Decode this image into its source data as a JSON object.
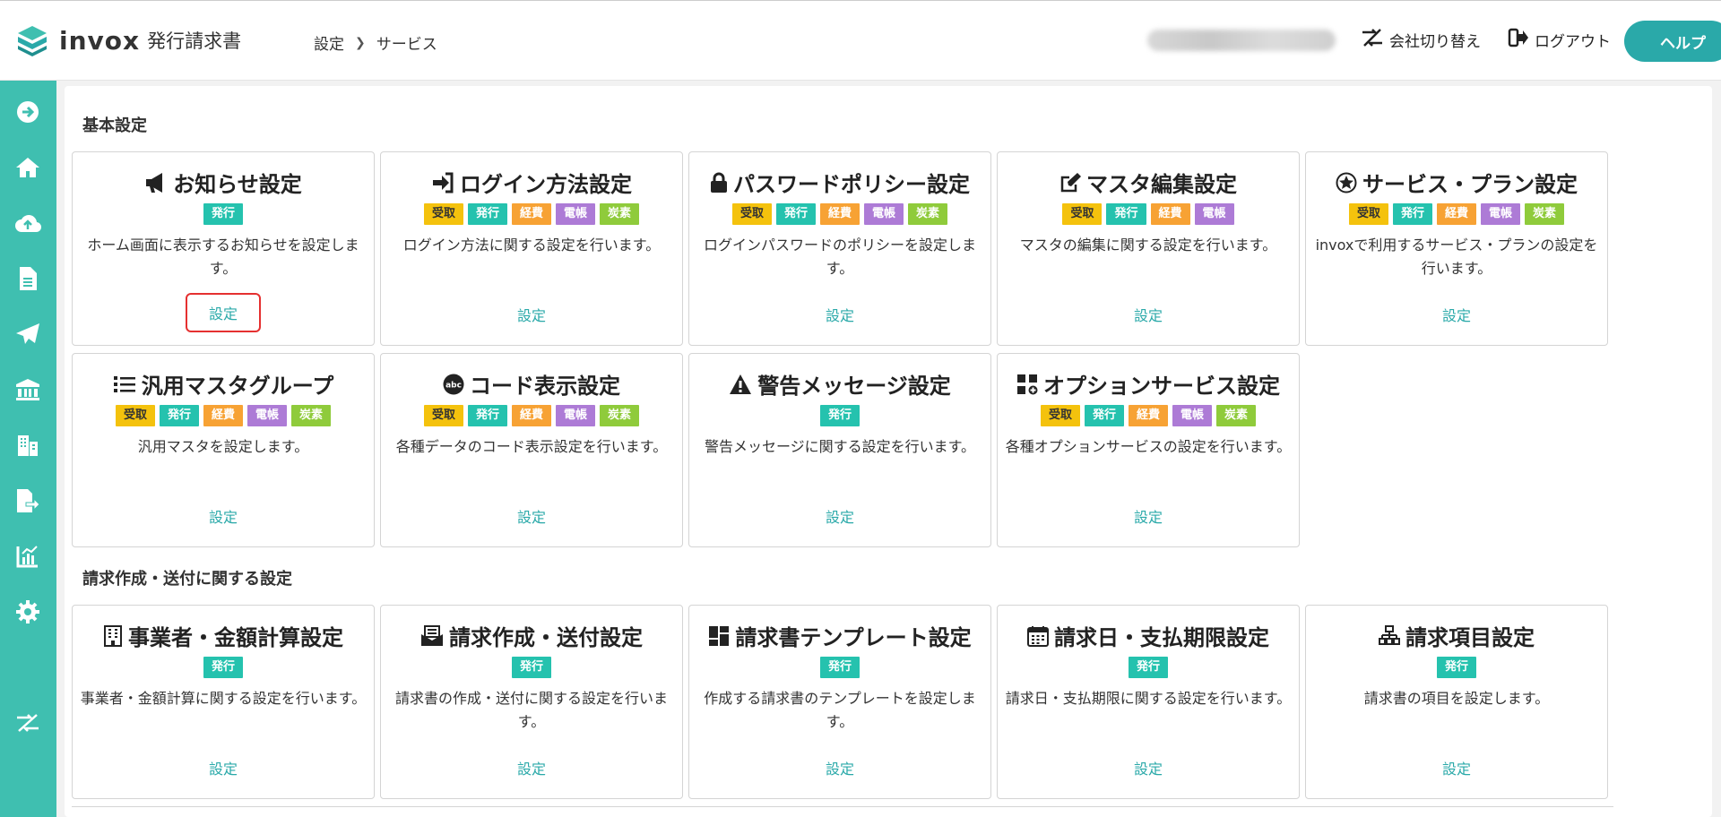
{
  "header": {
    "logo_text": "invox",
    "logo_sub": "発行請求書",
    "breadcrumb": [
      "設定",
      "サービス"
    ],
    "switch_company_label": "会社切り替え",
    "logout_label": "ログアウト",
    "help_label": "ヘルプ"
  },
  "colors": {
    "accent": "#2aa9a9",
    "sidebar": "#3fbfb0",
    "tag_receive": "#f4c20d",
    "tag_issue": "#25c2ae",
    "tag_expense": "#f7a234",
    "tag_ledger": "#ad7bd6",
    "tag_carbon": "#8fcb3b",
    "highlight_border": "#e53030"
  },
  "sidebar": {
    "icons": [
      "arrow-right-circle-icon",
      "home-icon",
      "cloud-upload-icon",
      "document-icon",
      "send-icon",
      "bank-icon",
      "building-icon",
      "file-export-icon",
      "chart-icon",
      "gear-icon",
      "switch-icon"
    ]
  },
  "sections": [
    {
      "title": "基本設定",
      "cards": [
        {
          "icon": "megaphone-icon",
          "title": "お知らせ設定",
          "tags": [
            "発行"
          ],
          "desc": "ホーム画面に表示するお知らせを設定します。",
          "link": "設定"
        },
        {
          "icon": "login-icon",
          "title": "ログイン方法設定",
          "tags": [
            "受取",
            "発行",
            "経費",
            "電帳",
            "炭素"
          ],
          "desc": "ログイン方法に関する設定を行います。",
          "link": "設定"
        },
        {
          "icon": "lock-icon",
          "title": "パスワードポリシー設定",
          "tags": [
            "受取",
            "発行",
            "経費",
            "電帳",
            "炭素"
          ],
          "desc": "ログインパスワードのポリシーを設定します。",
          "link": "設定"
        },
        {
          "icon": "edit-icon",
          "title": "マスタ編集設定",
          "tags": [
            "受取",
            "発行",
            "経費",
            "電帳"
          ],
          "desc": "マスタの編集に関する設定を行います。",
          "link": "設定"
        },
        {
          "icon": "star-badge-icon",
          "title": "サービス・プラン設定",
          "tags": [
            "受取",
            "発行",
            "経費",
            "電帳",
            "炭素"
          ],
          "desc": "invoxで利用するサービス・プランの設定を行います。",
          "link": "設定"
        },
        {
          "icon": "list-icon",
          "title": "汎用マスタグループ",
          "tags": [
            "受取",
            "発行",
            "経費",
            "電帳",
            "炭素"
          ],
          "desc": "汎用マスタを設定します。",
          "link": "設定"
        },
        {
          "icon": "abc-icon",
          "title": "コード表示設定",
          "tags": [
            "受取",
            "発行",
            "経費",
            "電帳",
            "炭素"
          ],
          "desc": "各種データのコード表示設定を行います。",
          "link": "設定"
        },
        {
          "icon": "warning-icon",
          "title": "警告メッセージ設定",
          "tags": [
            "発行"
          ],
          "desc": "警告メッセージに関する設定を行います。",
          "link": "設定"
        },
        {
          "icon": "grid-plus-icon",
          "title": "オプションサービス設定",
          "tags": [
            "受取",
            "発行",
            "経費",
            "電帳",
            "炭素"
          ],
          "desc": "各種オプションサービスの設定を行います。",
          "link": "設定"
        }
      ]
    },
    {
      "title": "請求作成・送付に関する設定",
      "cards": [
        {
          "icon": "building-icon",
          "title": "事業者・金額計算設定",
          "tags": [
            "発行"
          ],
          "desc": "事業者・金額計算に関する設定を行います。",
          "link": "設定"
        },
        {
          "icon": "mail-icon",
          "title": "請求作成・送付設定",
          "tags": [
            "発行"
          ],
          "desc": "請求書の作成・送付に関する設定を行います。",
          "link": "設定"
        },
        {
          "icon": "template-icon",
          "title": "請求書テンプレート設定",
          "tags": [
            "発行"
          ],
          "desc": "作成する請求書のテンプレートを設定します。",
          "link": "設定"
        },
        {
          "icon": "calendar-icon",
          "title": "請求日・支払期限設定",
          "tags": [
            "発行"
          ],
          "desc": "請求日・支払期限に関する設定を行います。",
          "link": "設定"
        },
        {
          "icon": "hierarchy-icon",
          "title": "請求項目設定",
          "tags": [
            "発行"
          ],
          "desc": "請求書の項目を設定します。",
          "link": "設定"
        }
      ]
    }
  ]
}
